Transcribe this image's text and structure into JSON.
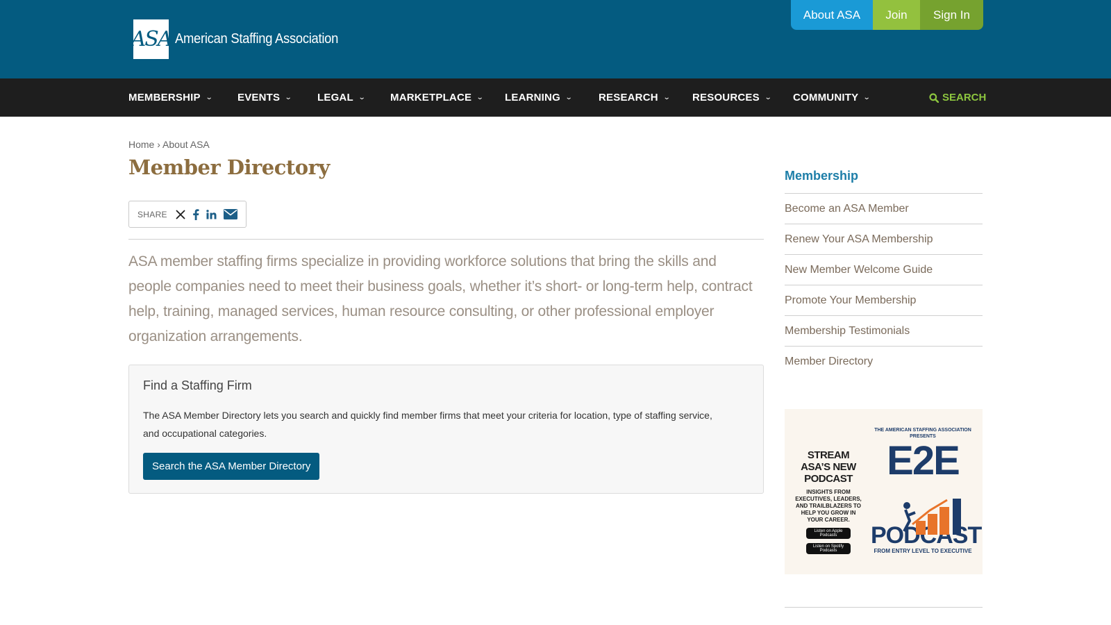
{
  "header": {
    "logo_mark": "ASA",
    "logo_text": "American Staffing Association",
    "util_nav": {
      "about": "About ASA",
      "join": "Join",
      "sign_in": "Sign In"
    }
  },
  "main_nav": {
    "items": [
      "MEMBERSHIP",
      "EVENTS",
      "LEGAL",
      "MARKETPLACE",
      "LEARNING",
      "RESEARCH",
      "RESOURCES",
      "COMMUNITY"
    ],
    "search_label": "SEARCH"
  },
  "breadcrumb": {
    "home": "Home",
    "separator": "›",
    "current": "About ASA"
  },
  "page": {
    "title": "Member Directory",
    "share_label": "SHARE",
    "intro": "ASA member staffing firms specialize in providing workforce solutions that bring the skills and people companies need to meet their business goals, whether it’s short- or long-term help, contract help, training, managed services, human resource consulting, or other professional employer organization arrangements."
  },
  "finder": {
    "title": "Find a Staffing Firm",
    "description": "The ASA Member Directory lets you search and quickly find member firms that meet your criteria for location, type of staffing service, and occupational categories.",
    "button": "Search the ASA Member Directory"
  },
  "sidebar": {
    "title": "Membership",
    "items": [
      "Become an ASA Member",
      "Renew Your ASA Membership",
      "New Member Welcome Guide",
      "Promote Your Membership",
      "Membership Testimonials",
      "Member Directory"
    ]
  },
  "promo": {
    "headline": "STREAM ASA’S NEW PODCAST",
    "tagline": "INSIGHTS FROM EXECUTIVES, LEADERS, AND TRAILBLAZERS TO HELP YOU GROW IN YOUR CAREER.",
    "apple": "Listen on Apple Podcasts",
    "spotify": "Listen on Spotify Podcasts",
    "presenter": "THE AMERICAN STAFFING ASSOCIATION PRESENTS",
    "show_name": "E2E",
    "show_type": "PODCAST",
    "show_sub": "FROM ENTRY LEVEL TO EXECUTIVE"
  },
  "colors": {
    "header_blue": "#045b80",
    "nav_dark": "#1e1e1e",
    "about_blue": "#1a9ad6",
    "join_green": "#93c13e",
    "signin_green": "#76a22f",
    "title_gold": "#8c6d3f",
    "search_green": "#8dc63f"
  }
}
